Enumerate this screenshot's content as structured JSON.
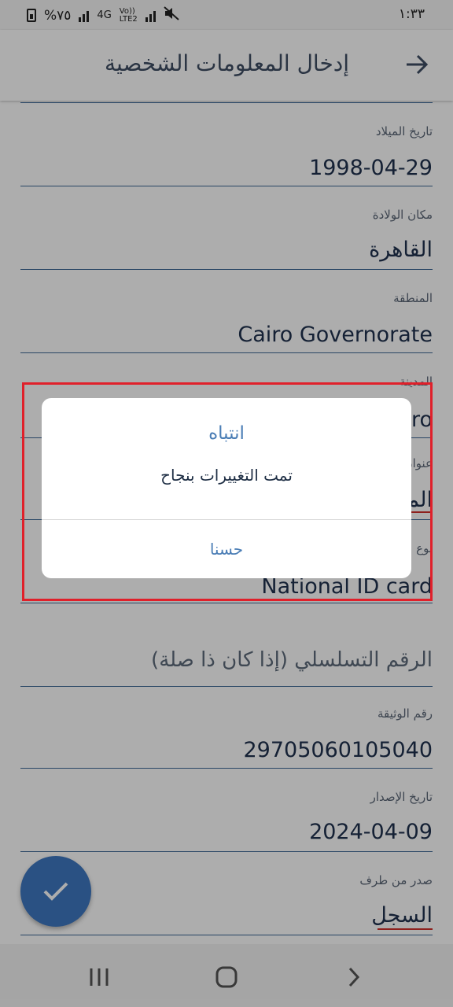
{
  "status_bar": {
    "battery_text": "%٧٥",
    "network_label": "4G",
    "volte_label": "Vo))\nLTE2",
    "time": "١:٣٣"
  },
  "app_bar": {
    "title": "إدخال المعلومات الشخصية",
    "back_icon": "arrow-right-icon"
  },
  "form": {
    "birth_date": {
      "label": "تاريخ الميلاد",
      "value": "1998-04-29"
    },
    "birth_place": {
      "label": "مكان الولادة",
      "value": "القاهرة"
    },
    "region": {
      "label": "المنطقة",
      "value": "Cairo Governorate"
    },
    "city": {
      "label": "المدينة",
      "value": "Cairo"
    },
    "address": {
      "label": "عنوان",
      "value": "المعادي"
    },
    "doc_type": {
      "label": "نوع",
      "value": "National ID card"
    },
    "serial_number": {
      "placeholder": "الرقم التسلسلي (إذا كان ذا صلة)"
    },
    "doc_number": {
      "label": "رقم الوثيقة",
      "value": "29705060105040"
    },
    "issue_date": {
      "label": "تاريخ الإصدار",
      "value": "2024-04-09"
    },
    "issued_by": {
      "label": "صدر من طرف",
      "value": "السجل"
    }
  },
  "dialog": {
    "title": "انتباه",
    "message": "تمت التغييرات بنجاح",
    "ok_label": "حسنا"
  },
  "colors": {
    "accent": "#4a7db5",
    "fab": "#3f78c2",
    "highlight": "#e0202a"
  }
}
